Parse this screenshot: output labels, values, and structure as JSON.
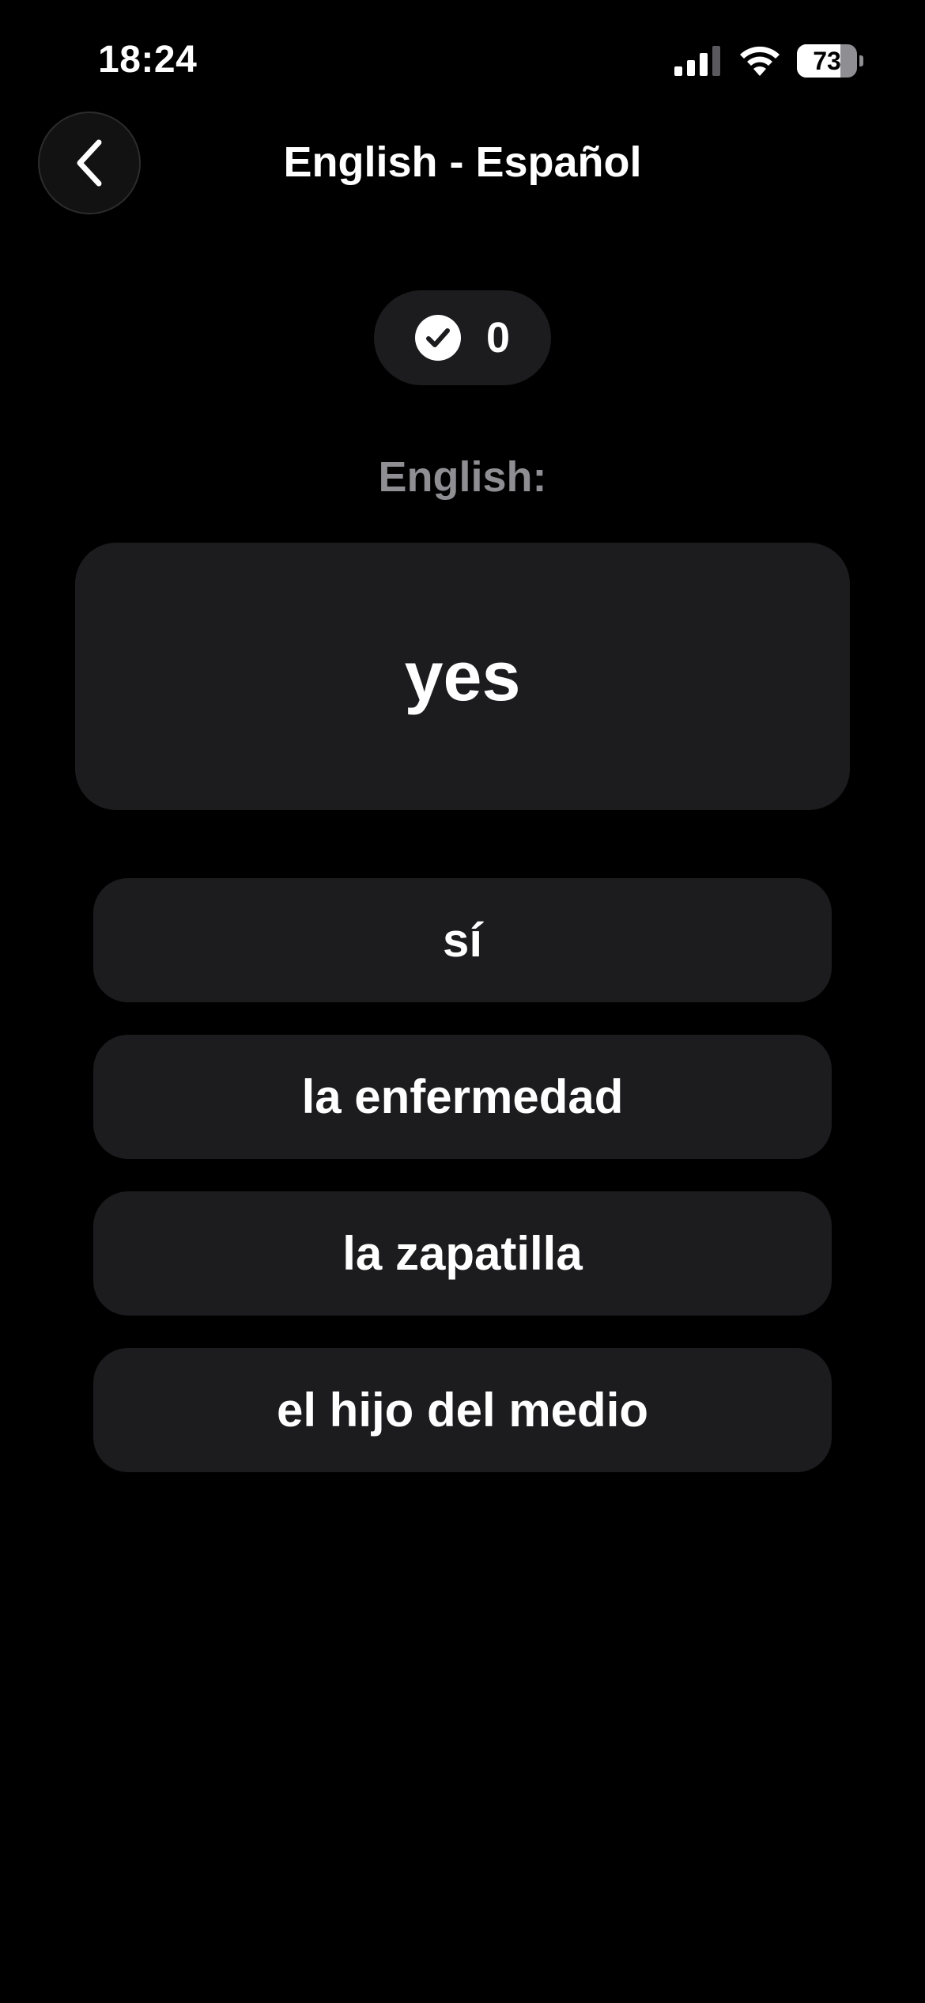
{
  "status_bar": {
    "time": "18:24",
    "battery_level": "73",
    "battery_fraction": 0.73,
    "icons": [
      "signal-icon",
      "wifi-icon",
      "battery-icon"
    ]
  },
  "header": {
    "back_icon": "chevron-left-icon",
    "title": "English - Español"
  },
  "score": {
    "icon": "check-circle-icon",
    "value": "0"
  },
  "prompt": {
    "language_label": "English:",
    "word": "yes"
  },
  "options": [
    {
      "label": "sí"
    },
    {
      "label": "la enfermedad"
    },
    {
      "label": "la zapatilla"
    },
    {
      "label": "el hijo del medio"
    }
  ],
  "colors": {
    "background": "#000000",
    "card": "#1c1c1e",
    "text": "#ffffff",
    "muted_text": "#8e8e93"
  }
}
